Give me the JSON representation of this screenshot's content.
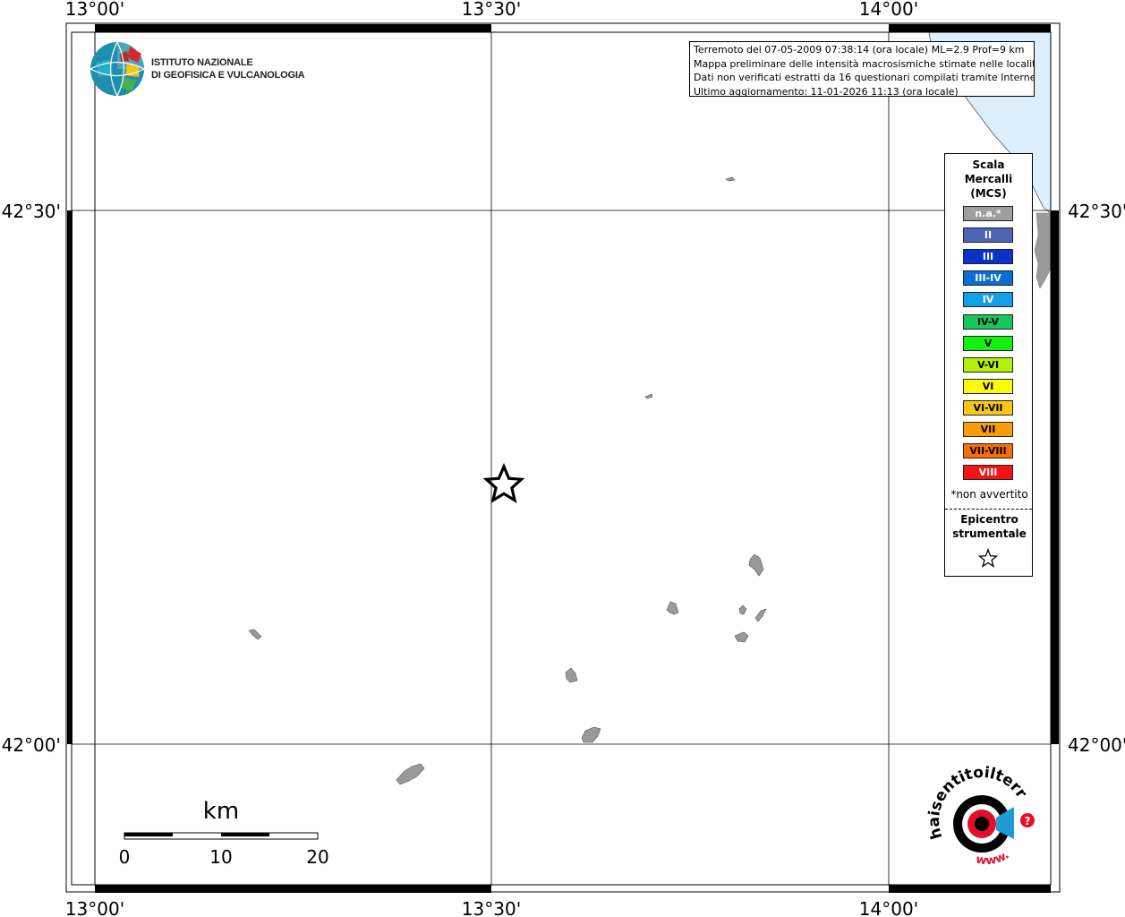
{
  "map": {
    "lon_labels": [
      "13°00'",
      "13°30'",
      "14°00'"
    ],
    "lat_labels": [
      "42°30'",
      "42°00'"
    ]
  },
  "info": {
    "line1": "Terremoto del 07-05-2009 07:38:14 (ora locale) ML=2.9 Prof=9 km",
    "line2": "Mappa preliminare delle intensità macrosismiche stimate nelle località",
    "line3": "Dati non verificati estratti da 16 questionari compilati tramite Internet.",
    "line4": "Ultimo aggiornamento: 11-01-2026 11:13 (ora locale)"
  },
  "logo": {
    "line1": "ISTITUTO NAZIONALE",
    "line2": "DI GEOFISICA E VULCANOLOGIA"
  },
  "legend": {
    "title1": "Scala",
    "title2": "Mercalli",
    "title3": "(MCS)",
    "classes": [
      {
        "label": "n.a.*",
        "color": "#9e9e9e",
        "text": "#ffffff"
      },
      {
        "label": "II",
        "color": "#5064b4",
        "text": "#ffffff"
      },
      {
        "label": "III",
        "color": "#0a32c8",
        "text": "#ffffff"
      },
      {
        "label": "III-IV",
        "color": "#0a6ed2",
        "text": "#ffffff"
      },
      {
        "label": "IV",
        "color": "#14a0e6",
        "text": "#ffffff"
      },
      {
        "label": "IV-V",
        "color": "#14c85a",
        "text": "#000000"
      },
      {
        "label": "V",
        "color": "#14f014",
        "text": "#000000"
      },
      {
        "label": "V-VI",
        "color": "#b4f00a",
        "text": "#000000"
      },
      {
        "label": "VI",
        "color": "#fafa0a",
        "text": "#000000"
      },
      {
        "label": "VI-VII",
        "color": "#fac814",
        "text": "#000000"
      },
      {
        "label": "VII",
        "color": "#fa9b0a",
        "text": "#000000"
      },
      {
        "label": "VII-VIII",
        "color": "#fa6e0a",
        "text": "#000000"
      },
      {
        "label": "VIII",
        "color": "#f01414",
        "text": "#ffffff"
      }
    ],
    "note": "*non avvertito",
    "epi1": "Epicentro",
    "epi2": "strumentale"
  },
  "scale_bar": {
    "unit": "km",
    "ticks": [
      "0",
      "10",
      "20"
    ]
  },
  "hst_logo": {
    "text": "haisentitoilterremoto.it",
    "url": "www."
  },
  "colors": {
    "sea": "#dcefff",
    "land_area": "#9a9a9a"
  }
}
